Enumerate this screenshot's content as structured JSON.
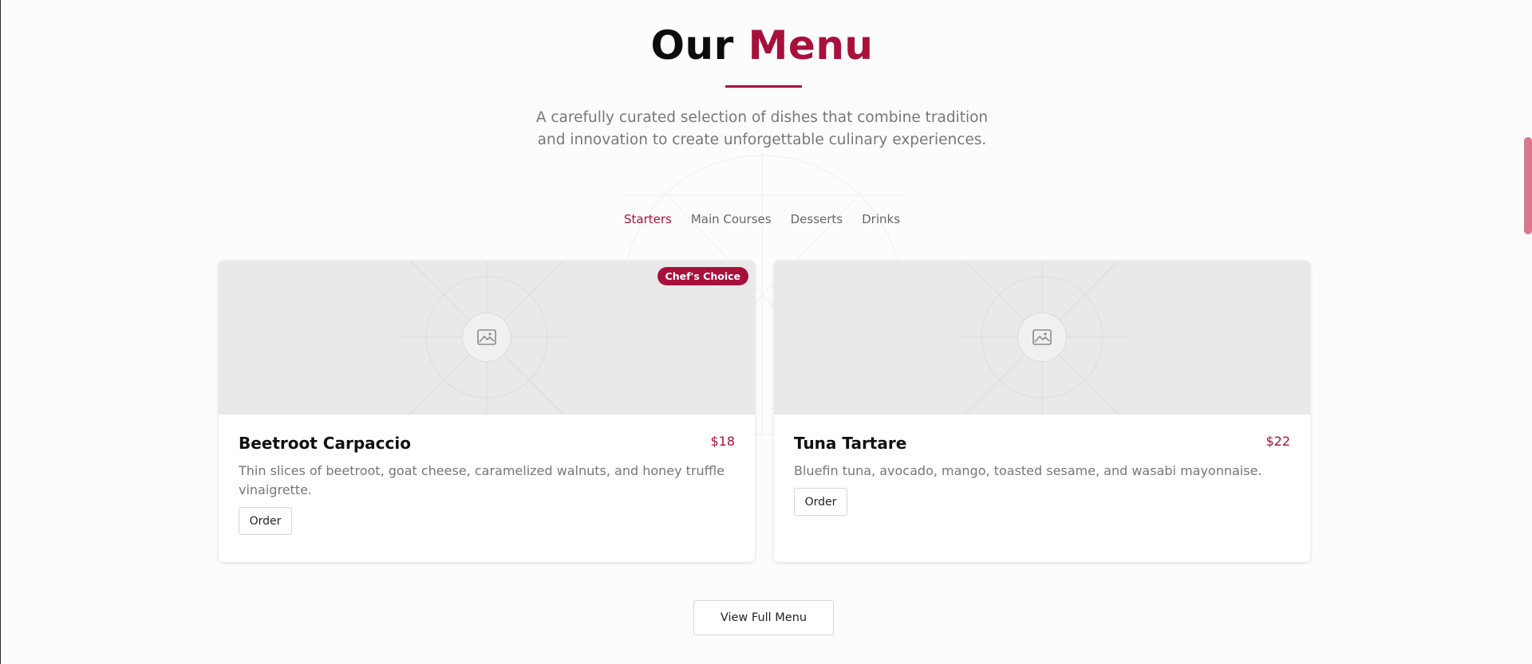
{
  "header": {
    "title_prefix": "Our",
    "title_accent": "Menu",
    "subtitle": "A carefully curated selection of dishes that combine tradition and innovation to create unforgettable culinary experiences."
  },
  "tabs": [
    {
      "label": "Starters",
      "active": true
    },
    {
      "label": "Main Courses",
      "active": false
    },
    {
      "label": "Desserts",
      "active": false
    },
    {
      "label": "Drinks",
      "active": false
    }
  ],
  "items": [
    {
      "name": "Beetroot Carpaccio",
      "price": "$18",
      "description": "Thin slices of beetroot, goat cheese, caramelized walnuts, and honey truffle vinaigrette.",
      "badge": "Chef's Choice",
      "order_label": "Order",
      "image_icon": "image-placeholder-icon"
    },
    {
      "name": "Tuna Tartare",
      "price": "$22",
      "description": "Bluefin tuna, avocado, mango, toasted sesame, and wasabi mayonnaise.",
      "order_label": "Order",
      "image_icon": "image-placeholder-icon"
    }
  ],
  "footer": {
    "view_full_menu_label": "View Full Menu"
  },
  "colors": {
    "accent": "#a8103c",
    "background": "#fcfcfc",
    "image_placeholder": "#e9e9e9",
    "muted_text": "#777777"
  }
}
